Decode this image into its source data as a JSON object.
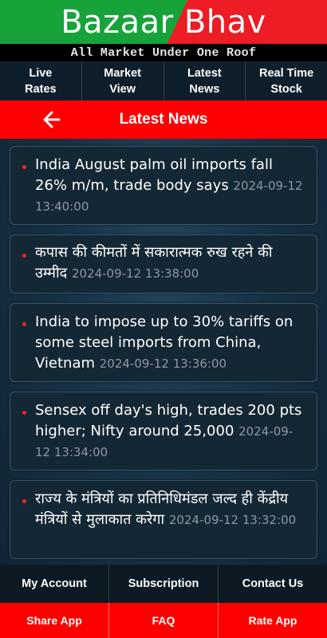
{
  "app": {
    "title": "Bazaar Bhav",
    "tagline": "All Market Under One Roof"
  },
  "top_nav": [
    {
      "label": "Live\nRates"
    },
    {
      "label": "Market\nView"
    },
    {
      "label": "Latest\nNews"
    },
    {
      "label": "Real Time\nStock"
    }
  ],
  "header": {
    "title": "Latest News",
    "back_icon": "arrow-left-icon"
  },
  "news": [
    {
      "headline": "India August palm oil imports fall 26% m/m, trade body says",
      "time": "2024-09-12 13:40:00"
    },
    {
      "headline": "कपास की कीमतों में सकारात्मक रुख रहने की उम्मीद",
      "time": "2024-09-12 13:38:00"
    },
    {
      "headline": "India to impose up to 30% tariffs on some steel imports from China, Vietnam",
      "time": "2024-09-12 13:36:00"
    },
    {
      "headline": "Sensex off day's high, trades 200 pts higher; Nifty around 25,000",
      "time": "2024-09-12 13:34:00"
    },
    {
      "headline": "राज्य के मंत्रियों का प्रतिनिधिमंडल जल्द ही केंद्रीय मंत्रियों से मुलाकात करेगा",
      "time": "2024-09-12 13:32:00"
    }
  ],
  "bottom_nav": [
    {
      "label": "My Account"
    },
    {
      "label": "Subscription"
    },
    {
      "label": "Contact Us"
    }
  ],
  "bottom_nav_secondary": [
    {
      "label": "Share App"
    },
    {
      "label": "FAQ"
    },
    {
      "label": "Rate App"
    }
  ],
  "colors": {
    "brand_green": "#17a33a",
    "brand_red": "#ee1c24",
    "accent_red": "#ff0000",
    "background": "#173246",
    "timestamp_gray": "#8d98a3"
  }
}
